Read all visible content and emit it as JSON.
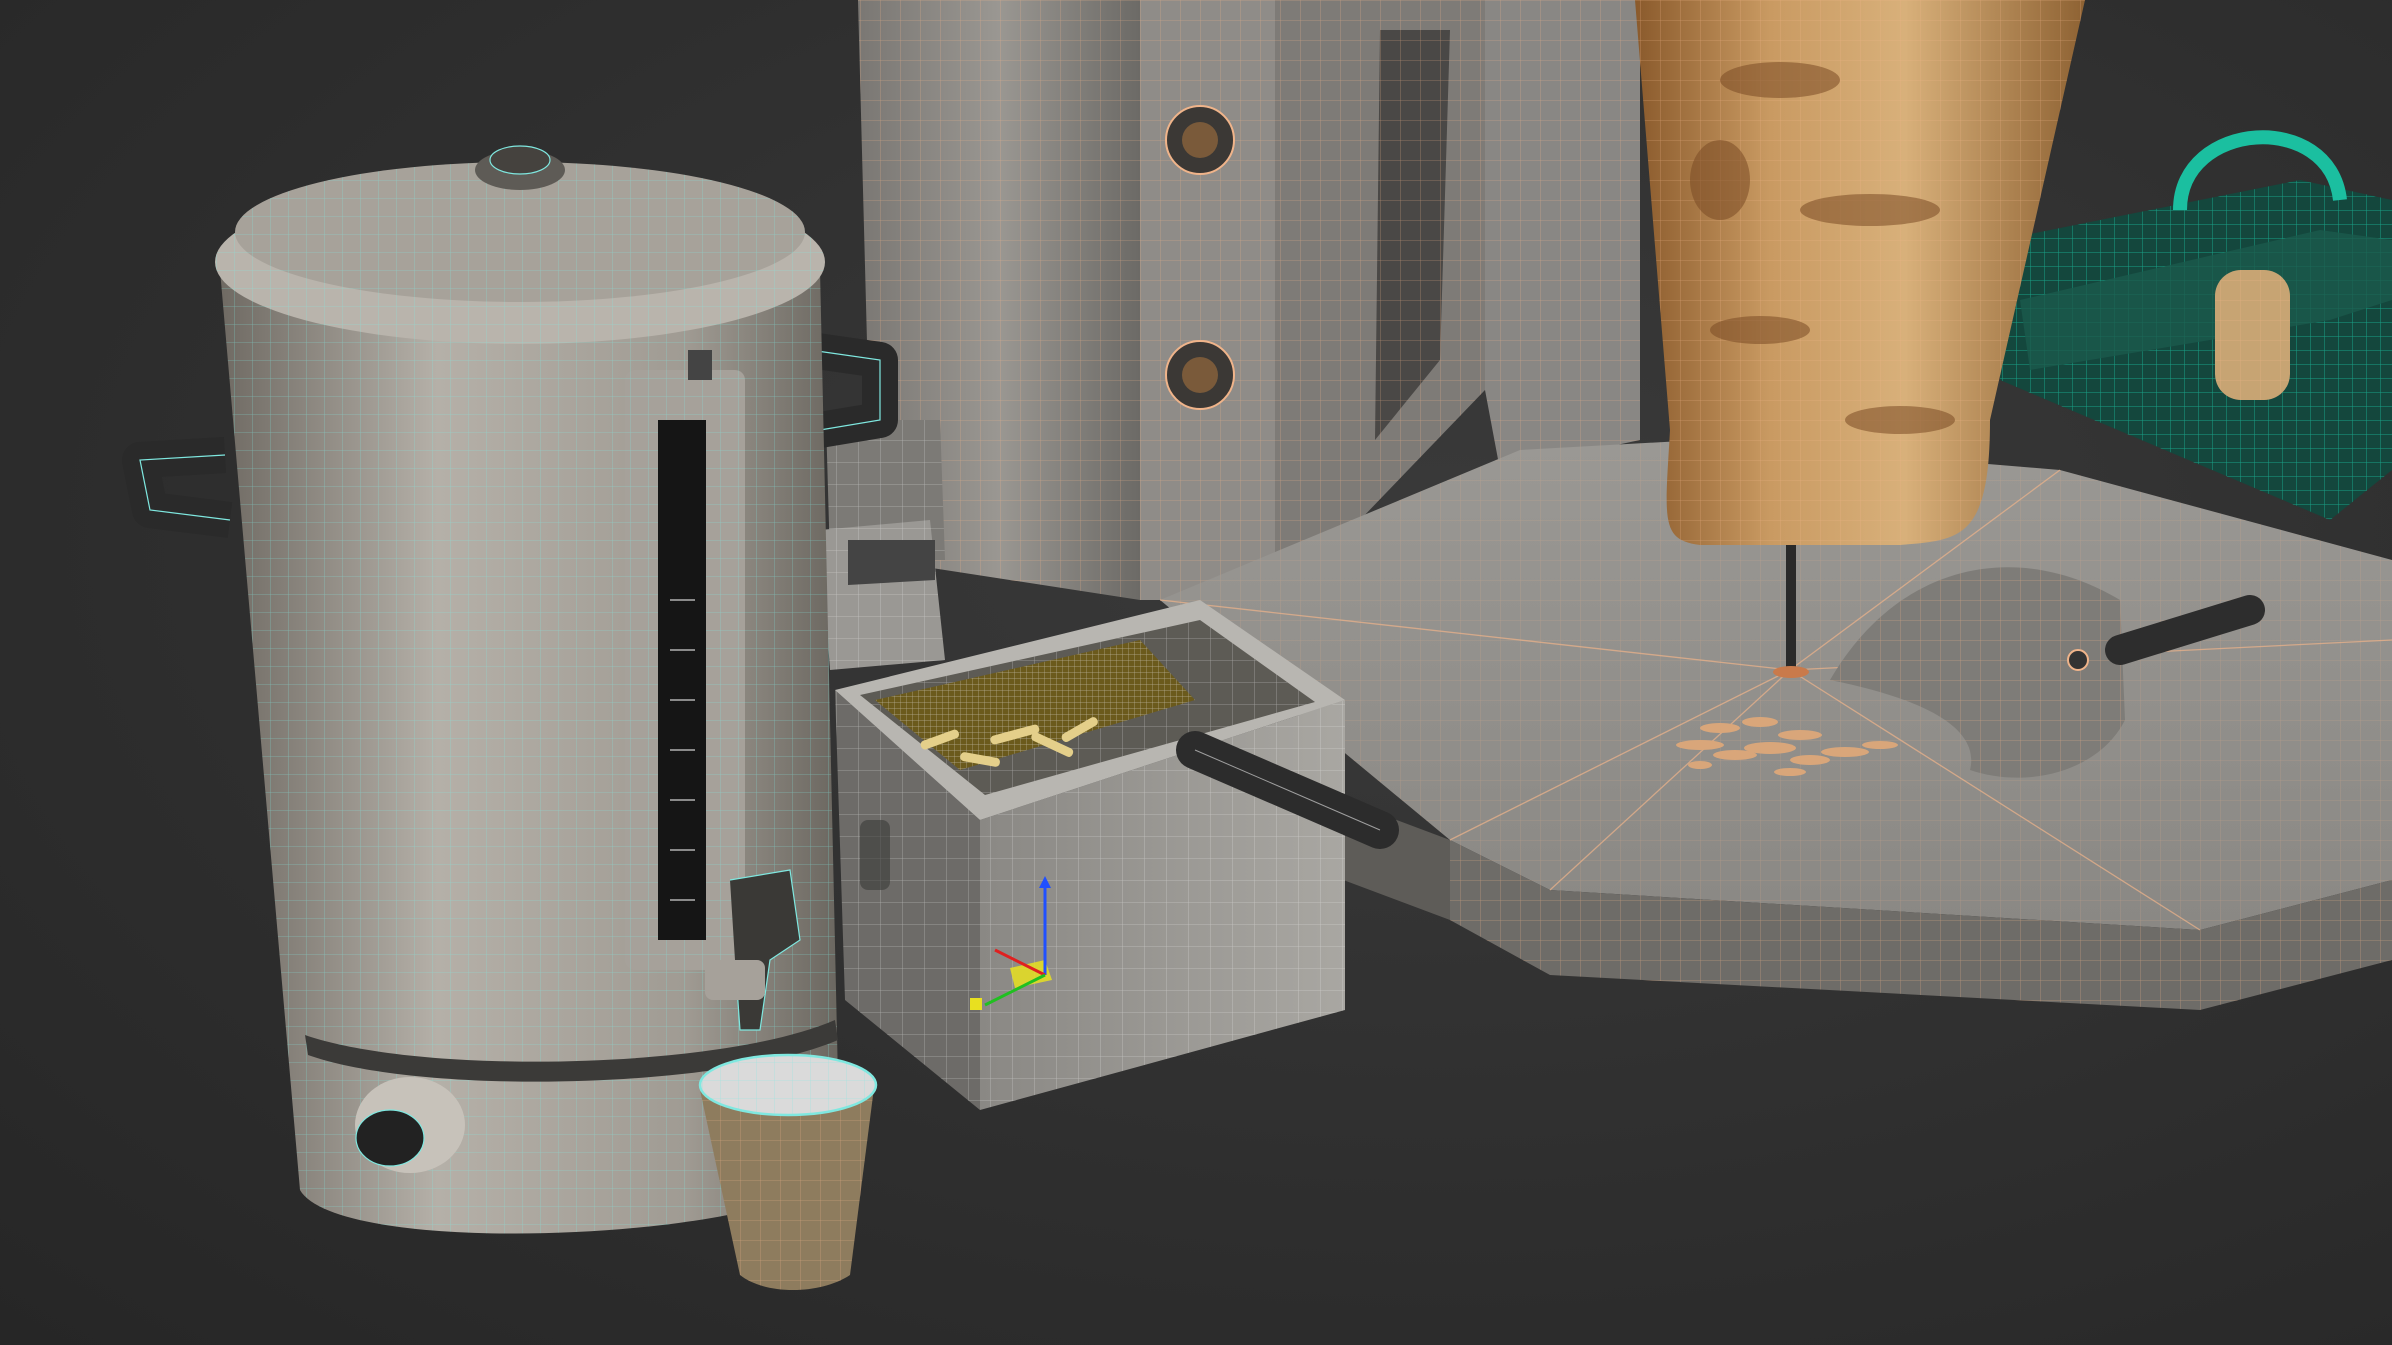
{
  "viewport": {
    "background": "#2f2f2f"
  },
  "colors": {
    "wire_cyan": "#7fe8e0",
    "wire_orange": "#f0b48a",
    "wire_white": "#e8e8e8",
    "wire_teal": "#1bbfa0",
    "metal": "#8e8a84",
    "metal_light": "#b7b3ab",
    "meat": "#b5834f",
    "oil": "#6b5a1c",
    "axis_x": "#e02020",
    "axis_y": "#20c020",
    "axis_z": "#2050ff",
    "gizmo_plane": "#e8e020"
  },
  "scene": {
    "objects": [
      {
        "id": "water-boiler",
        "icon": "urn-icon"
      },
      {
        "id": "paper-cup",
        "icon": "cup-icon"
      },
      {
        "id": "deep-fryer",
        "icon": "fryer-icon"
      },
      {
        "id": "fryer-basket",
        "icon": "basket-icon"
      },
      {
        "id": "doner-grill",
        "icon": "grill-icon"
      },
      {
        "id": "doner-meat-cone",
        "icon": "meat-icon"
      },
      {
        "id": "meat-shovel",
        "icon": "shovel-icon"
      },
      {
        "id": "meat-shavings",
        "icon": "food-icon"
      },
      {
        "id": "contact-grill",
        "icon": "press-grill-icon"
      }
    ]
  }
}
